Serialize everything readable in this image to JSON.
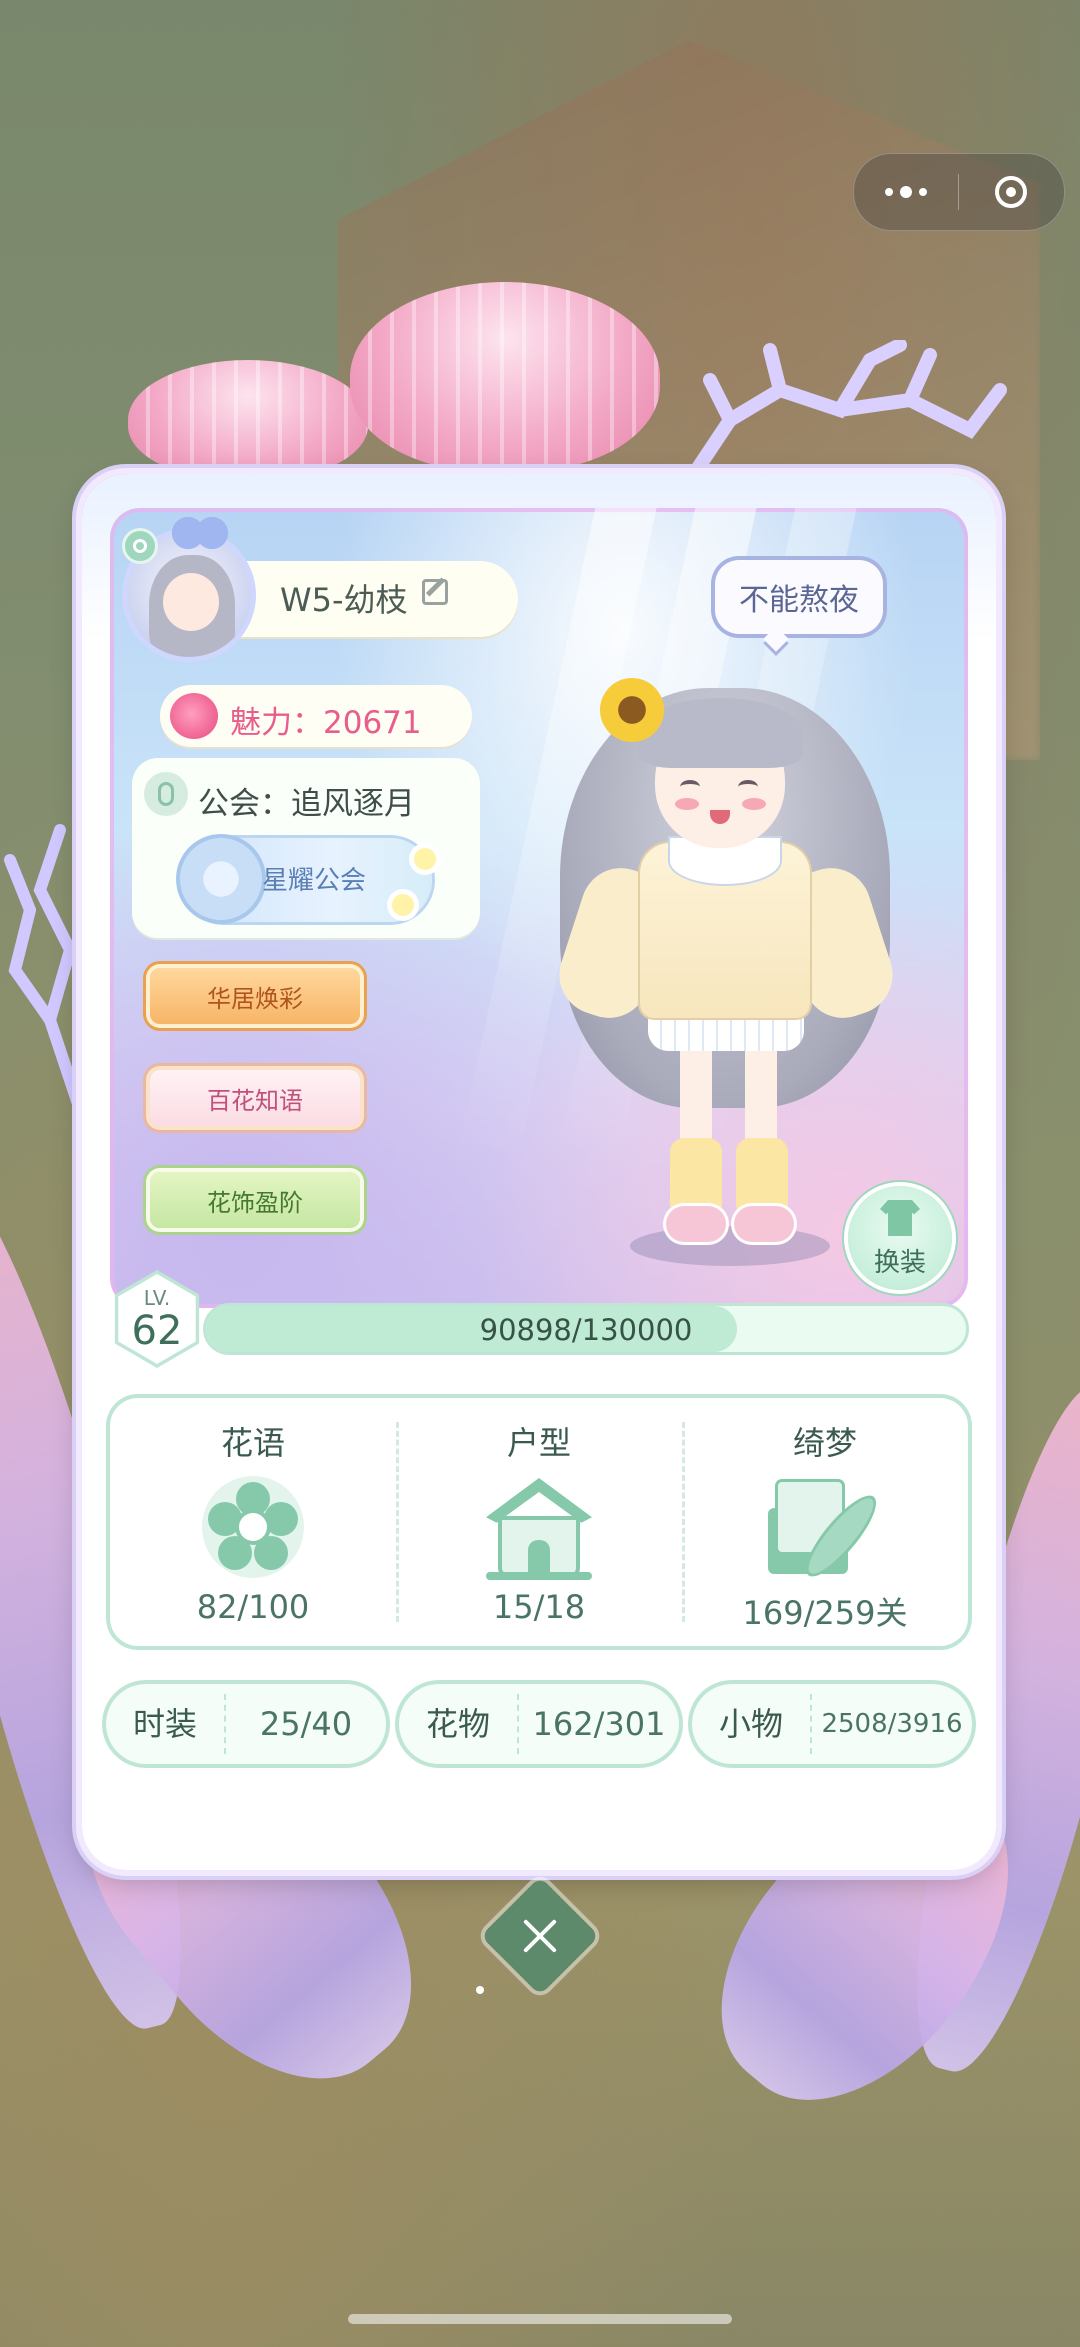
{
  "player": {
    "name": "W5-幼枝",
    "charm": "魅力：20671",
    "guild": "公会：追风逐月",
    "guild_badge": "星耀公会",
    "signature": "不能熬夜"
  },
  "banners": [
    "华居焕彩",
    "百花知语",
    "花饰盈阶"
  ],
  "wardrobe_label": "换装",
  "level": {
    "label": "LV.",
    "value": "62",
    "exp_text": "90898/130000",
    "exp_fraction": 0.699
  },
  "stats": [
    {
      "title": "花语",
      "value": "82/100",
      "icon": "flower-icon"
    },
    {
      "title": "户型",
      "value": "15/18",
      "icon": "house-icon"
    },
    {
      "title": "绮梦",
      "value": "169/259关",
      "icon": "letter-quill-icon"
    }
  ],
  "counters": [
    {
      "label": "时装",
      "value": "25/40"
    },
    {
      "label": "花物",
      "value": "162/301"
    },
    {
      "label": "小物",
      "value": "2508/3916"
    }
  ],
  "colors": {
    "accent_green": "#86c9aa",
    "charm_pink": "#e85d8c",
    "close_button": "#5c8a6a"
  }
}
